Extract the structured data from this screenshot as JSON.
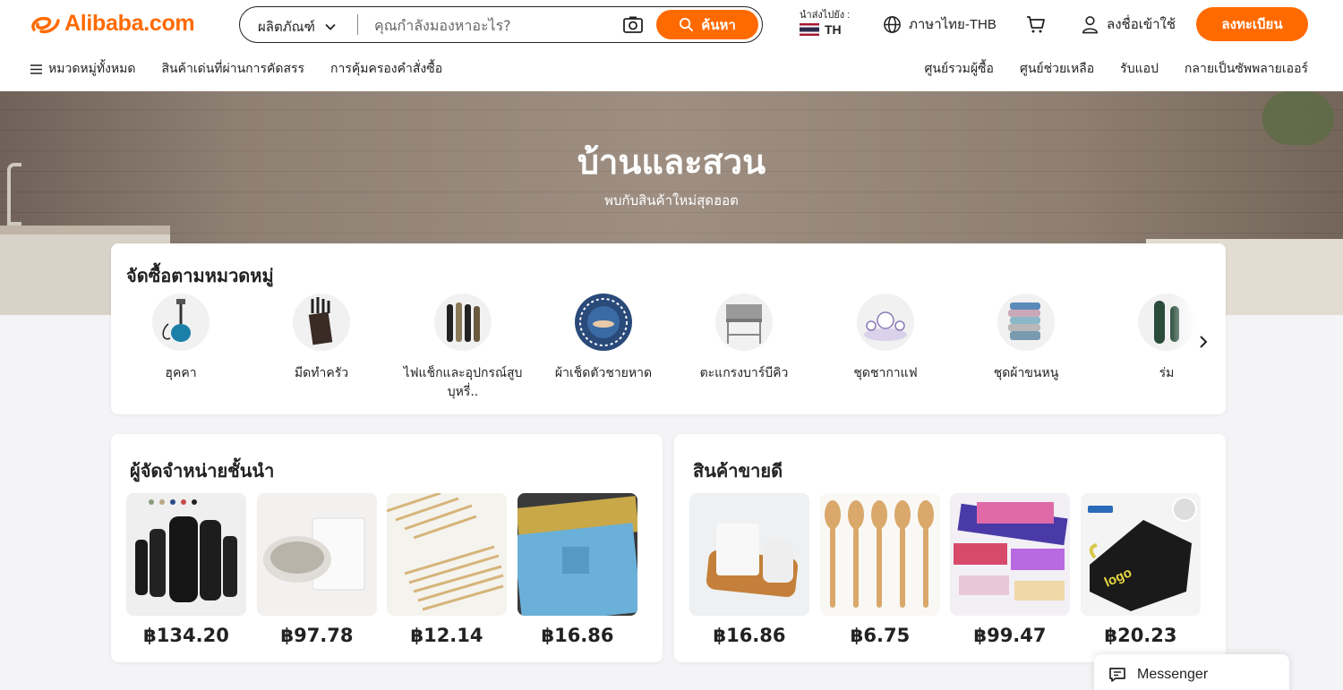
{
  "header": {
    "logo_text": "Alibaba.com",
    "search": {
      "type_label": "ผลิตภัณฑ์",
      "placeholder": "คุณกำลังมองหาอะไร?",
      "button_label": "ค้นหา"
    },
    "ship_to": {
      "label": "นำส่งไปยัง :",
      "country": "TH"
    },
    "language_label": "ภาษาไทย-THB",
    "signin_label": "ลงชื่อเข้าใช้",
    "register_label": "ลงทะเบียน"
  },
  "nav": {
    "left": [
      "หมวดหมู่ทั้งหมด",
      "สินค้าเด่นที่ผ่านการคัดสรร",
      "การคุ้มครองคำสั่งซื้อ"
    ],
    "right": [
      "ศูนย์รวมผู้ซื้อ",
      "ศูนย์ช่วยเหลือ",
      "รับแอป",
      "กลายเป็นซัพพลายเออร์"
    ]
  },
  "hero": {
    "title": "บ้านและสวน",
    "subtitle": "พบกับสินค้าใหม่สุดฮอต"
  },
  "categories": {
    "title": "จัดซื้อตามหมวดหมู่",
    "items": [
      {
        "label": "ฮุคคา",
        "icon": "hookah"
      },
      {
        "label": "มีดทำครัว",
        "icon": "knife-block"
      },
      {
        "label": "ไฟแช็กและอุปกรณ์สูบบุหรี่..",
        "icon": "lighters"
      },
      {
        "label": "ผ้าเช็ดตัวชายหาด",
        "icon": "beach-towel"
      },
      {
        "label": "ตะแกรงบาร์บีคิว",
        "icon": "bbq-grill"
      },
      {
        "label": "ชุดชากาแฟ",
        "icon": "tea-set"
      },
      {
        "label": "ชุดผ้าขนหนู",
        "icon": "towel-set"
      },
      {
        "label": "ร่ม",
        "icon": "umbrella"
      }
    ]
  },
  "top_suppliers": {
    "title": "ผู้จัดจำหน่ายชั้นนำ",
    "products": [
      {
        "price": "฿134.20",
        "image": "water-bottles"
      },
      {
        "price": "฿97.78",
        "image": "scented-candle"
      },
      {
        "price": "฿12.14",
        "image": "bamboo-skewers"
      },
      {
        "price": "฿16.86",
        "image": "microfiber-towel"
      }
    ]
  },
  "best_sellers": {
    "title": "สินค้าขายดี",
    "products": [
      {
        "price": "฿16.86",
        "image": "candle-tray"
      },
      {
        "price": "฿6.75",
        "image": "wooden-spoons"
      },
      {
        "price": "฿99.47",
        "image": "soap-roses"
      },
      {
        "price": "฿20.23",
        "image": "logo-towels",
        "badge": "logo"
      }
    ]
  },
  "messenger": {
    "label": "Messenger"
  },
  "colors": {
    "accent": "#ff6a00",
    "text": "#222222",
    "background": "#f4f4f6"
  }
}
